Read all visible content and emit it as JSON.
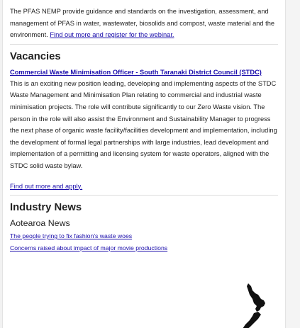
{
  "intro": {
    "text": "The PFAS NEMP provide guidance and standards on the investigation, assessment, and management of PFAS in water, wastewater, biosolids and compost, waste material and the environment. ",
    "link": "Find out more and register for the webinar."
  },
  "vacancies": {
    "heading": "Vacancies",
    "job_title": "Commercial Waste Minimisation Officer - South Taranaki District Council (STDC)",
    "description": "This is an exciting new position leading, developing and implementing aspects of the STDC Waste Management and Minimisation Plan relating to commercial and industrial waste minimisation projects. The role will contribute significantly to our Zero Waste vision. The person in the role will also assist the Environment and Sustainability Manager to progress the next phase of organic waste facility/facilities development and implementation, including the development of formal legal partnerships with large industries, lead development and implementation of a permitting and licensing system for waste operators, aligned with the STDC solid waste bylaw.",
    "apply_link": "Find out more and apply."
  },
  "industry_news": {
    "heading": "Industry News",
    "sub_heading": "Aotearoa News",
    "items": [
      "The people trying to fix fashion's waste woes",
      "Concerns raised about impact of major movie productions"
    ]
  },
  "colors": {
    "link": "#1a0dab",
    "text": "#222222",
    "map": "#111111"
  },
  "icons": {
    "map": "new-zealand-map-icon"
  }
}
